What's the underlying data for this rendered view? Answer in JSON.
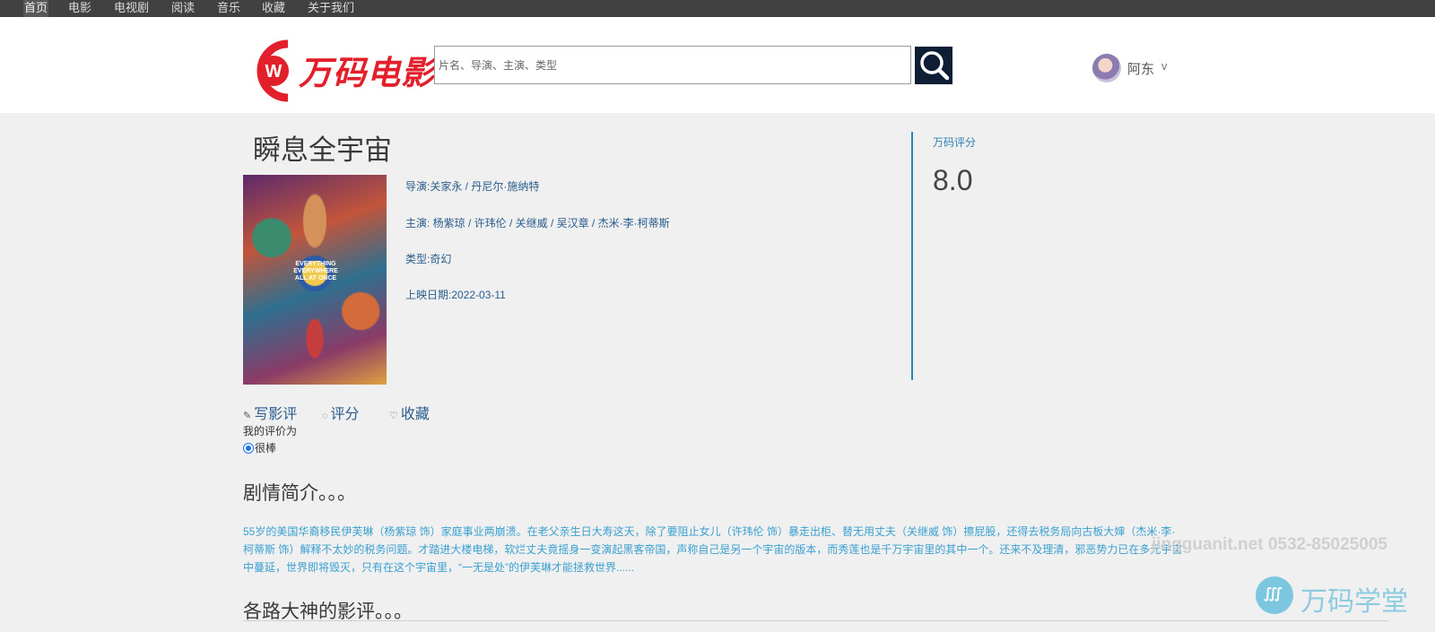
{
  "nav": {
    "items": [
      {
        "label": "首页",
        "active": true
      },
      {
        "label": "电影"
      },
      {
        "label": "电视剧"
      },
      {
        "label": "阅读"
      },
      {
        "label": "音乐"
      },
      {
        "label": "收藏"
      },
      {
        "label": "关于我们"
      }
    ]
  },
  "header": {
    "logo_text": "万码电影",
    "search_placeholder": "片名、导演、主演、类型",
    "search_icon": "search-icon",
    "user_name": "阿东",
    "user_chevron": "v"
  },
  "movie": {
    "title": "瞬息全宇宙",
    "poster_text": "EVERYTHING EVERYWHERE ALL AT ONCE",
    "director": "导演:关家永 / 丹尼尔·施纳特",
    "cast": "主演: 杨紫琼 / 许玮伦 / 关继威 / 吴汉章 / 杰米·李·柯蒂斯",
    "genre": "类型:奇幻",
    "release_date": "上映日期:2022-03-11",
    "score_label": "万码评分",
    "score": "8.0"
  },
  "actions": {
    "write_review": "写影评",
    "rate": "评分",
    "favorite": "收藏",
    "my_rating_label": "我的评价为",
    "my_rating_value": "很棒"
  },
  "synopsis": {
    "heading": "剧情简介。。。",
    "text": "55岁的美国华裔移民伊芙琳（杨紫琼 饰）家庭事业两崩溃。在老父亲生日大寿这天，除了要阻止女儿（许玮伦 饰）暴走出柜、替无用丈夫（关继威 饰）擦屁股，还得去税务局向古板大婶（杰米·李·柯蒂斯 饰）解释不太妙的税务问题。才踏进大楼电梯，软烂丈夫竟摇身一变演起黑客帝国，声称自己是另一个宇宙的版本，而秀莲也是千万宇宙里的其中一个。还来不及理清，邪恶势力已在多元宇宙中蔓延，世界即将毁灭，只有在这个宇宙里，“一无是处”的伊芙琳才能拯救世界......"
  },
  "reviews": {
    "heading": "各路大神的影评。。。"
  },
  "watermark": {
    "text": "jingguanit.net 0532-85025005",
    "brand": "万码学堂"
  }
}
